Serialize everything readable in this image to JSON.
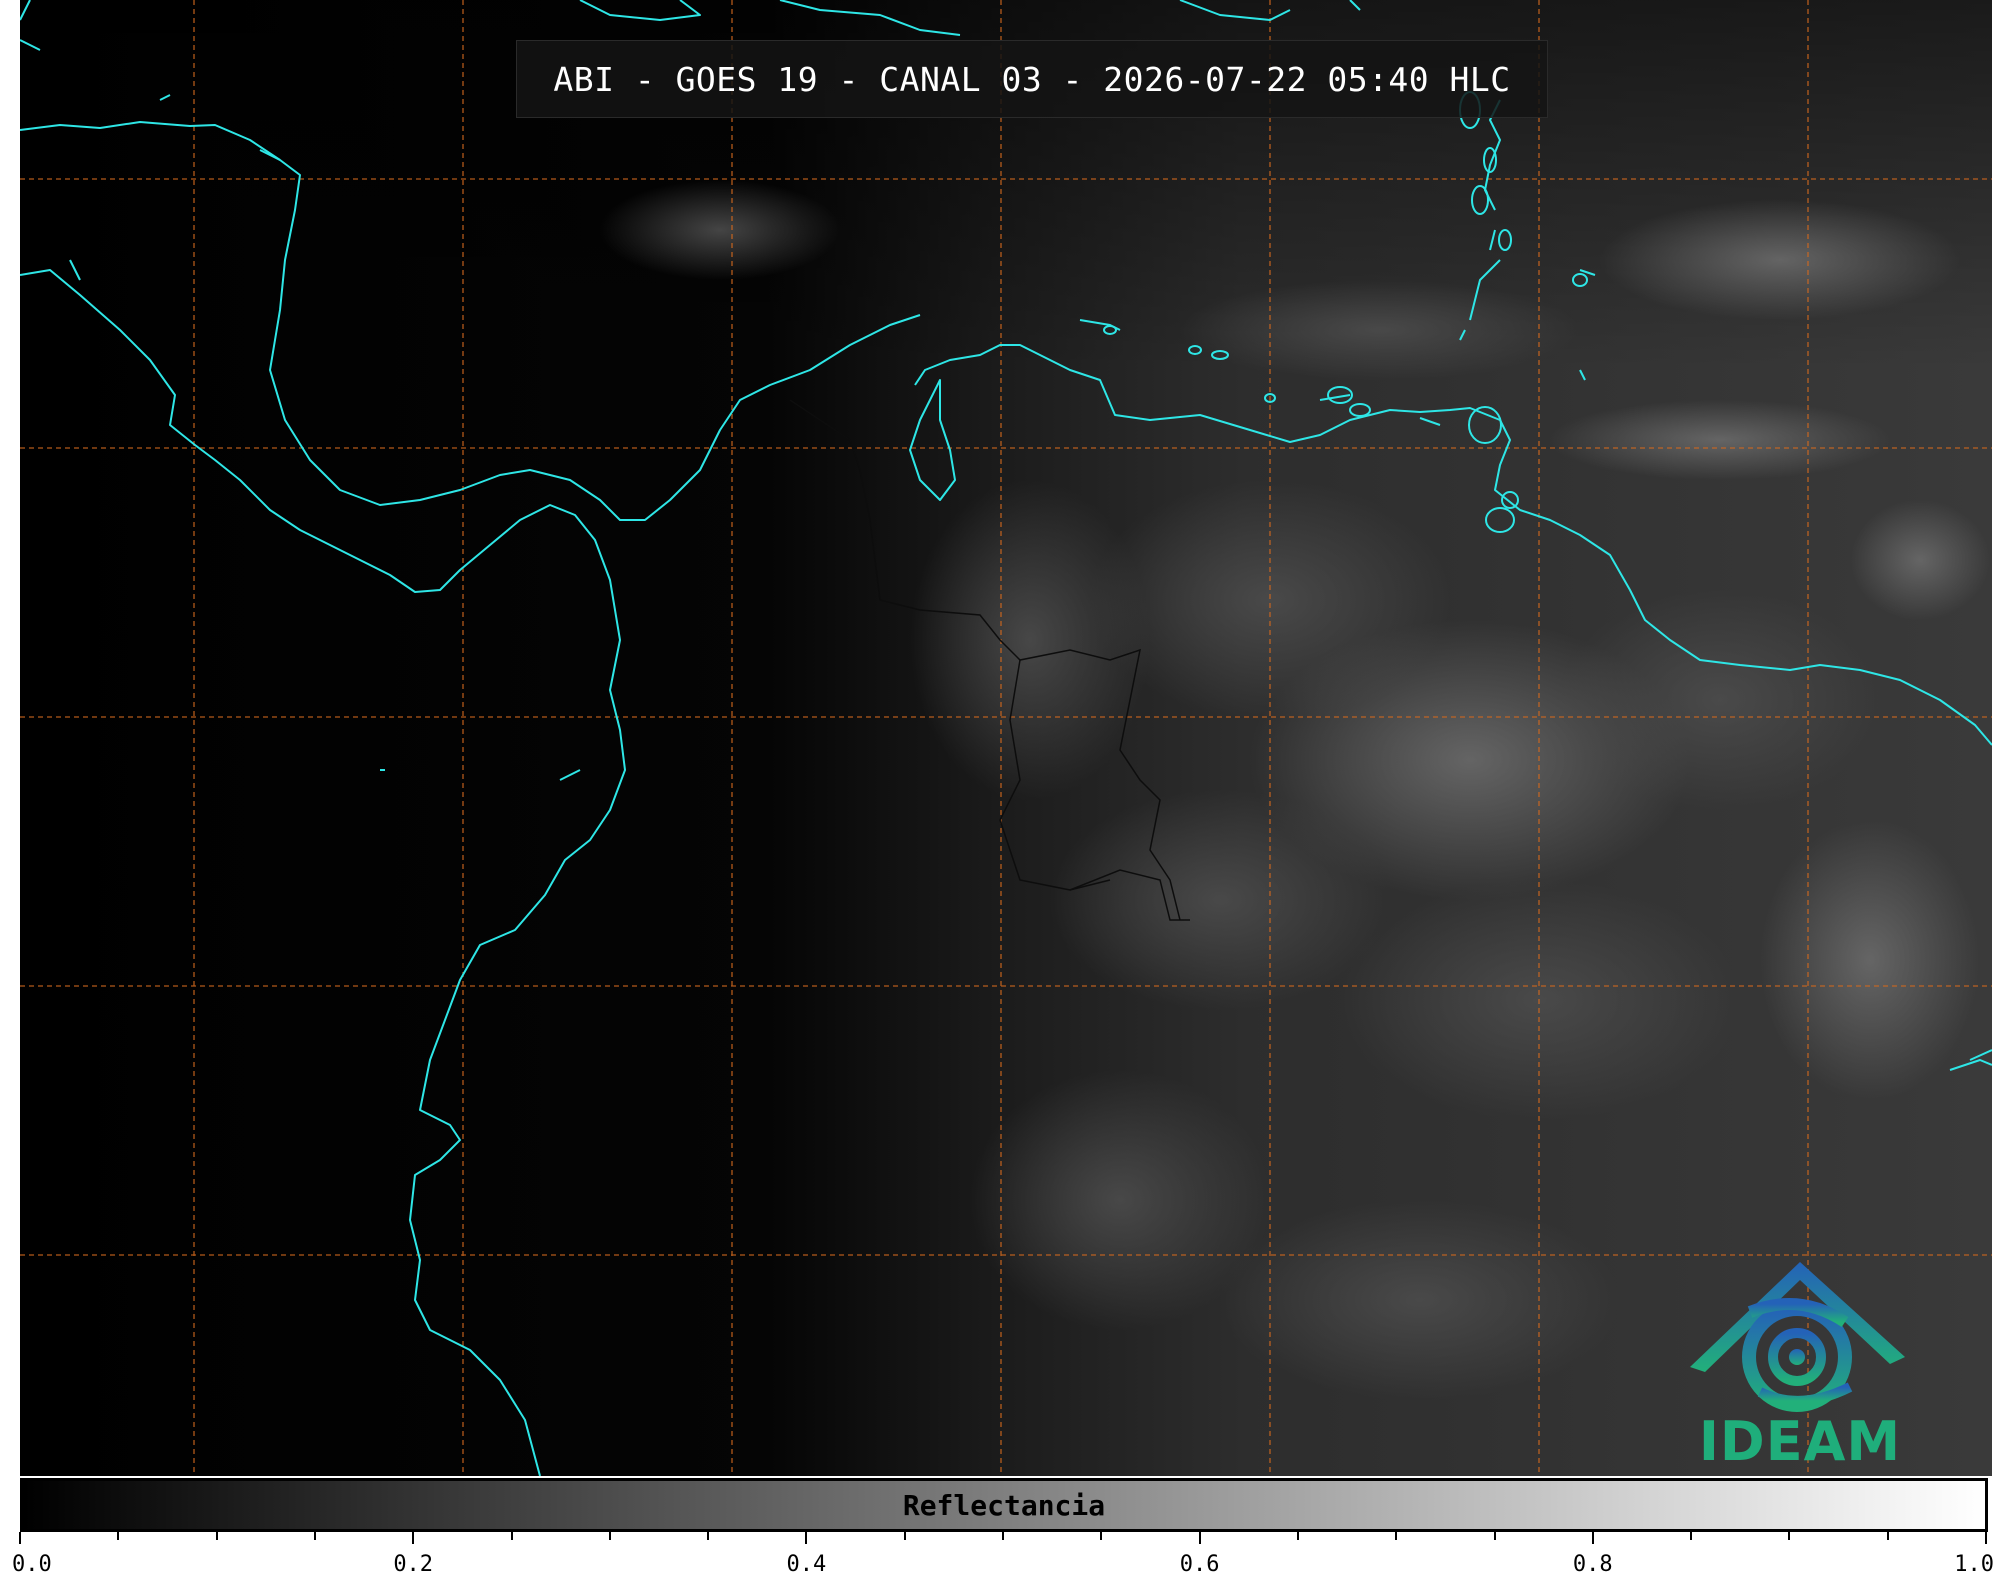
{
  "title": "ABI - GOES 19 - CANAL 03 - 2026-07-22 05:40 HLC",
  "logo": {
    "text": "IDEAM",
    "icon": "ideam-volcano-swirl-icon",
    "color": "#1fae7b"
  },
  "colorbar": {
    "label": "Reflectancia",
    "min": 0.0,
    "max": 1.0,
    "tick_labels": [
      "0.0",
      "0.2",
      "0.4",
      "0.6",
      "0.8",
      "1.0"
    ],
    "colormap": "grayscale"
  },
  "colors": {
    "coastline": "#2ee6e6",
    "gridlines": "#d2691e",
    "background": "#000000",
    "borders": "#111111"
  }
}
